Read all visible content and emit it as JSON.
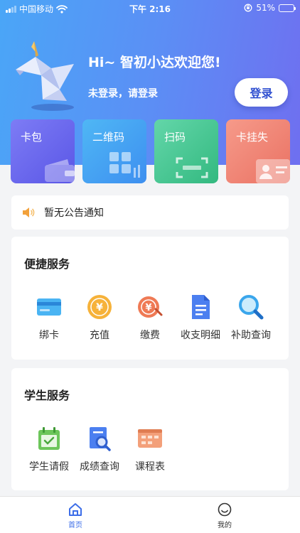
{
  "status_bar": {
    "carrier": "中国移动",
    "time": "下午 2:16",
    "battery": "51%",
    "battery_level": 0.51
  },
  "header": {
    "greeting": "Hi~ 智初小达欢迎您!",
    "login_hint": "未登录，请登录",
    "login_button": "登录",
    "colors": {
      "gradient_start": "#4aa6f7",
      "gradient_end": "#6f6ff0"
    }
  },
  "quick_actions": [
    {
      "label": "卡包",
      "icon": "wallet-icon",
      "color": "#6a68ee"
    },
    {
      "label": "二维码",
      "icon": "qr-code-icon",
      "color": "#46a2f2"
    },
    {
      "label": "扫码",
      "icon": "scan-icon",
      "color": "#45c690"
    },
    {
      "label": "卡挂失",
      "icon": "id-card-icon",
      "color": "#ef8373"
    }
  ],
  "notice": {
    "icon": "speaker-icon",
    "text": "暂无公告通知"
  },
  "convenient_services": {
    "title": "便捷服务",
    "items": [
      {
        "label": "绑卡",
        "icon": "bank-card-icon"
      },
      {
        "label": "充值",
        "icon": "yuan-coin-icon"
      },
      {
        "label": "缴费",
        "icon": "payment-icon"
      },
      {
        "label": "收支明细",
        "icon": "document-icon"
      },
      {
        "label": "补助查询",
        "icon": "magnifier-icon"
      }
    ]
  },
  "student_services": {
    "title": "学生服务",
    "items": [
      {
        "label": "学生请假",
        "icon": "calendar-icon"
      },
      {
        "label": "成绩查询",
        "icon": "grade-search-icon"
      },
      {
        "label": "课程表",
        "icon": "schedule-icon"
      }
    ]
  },
  "tab_bar": {
    "tabs": [
      {
        "label": "首页",
        "icon": "home-icon",
        "active": true
      },
      {
        "label": "我的",
        "icon": "smiley-icon",
        "active": false
      }
    ],
    "active_color": "#3d6ee8"
  }
}
